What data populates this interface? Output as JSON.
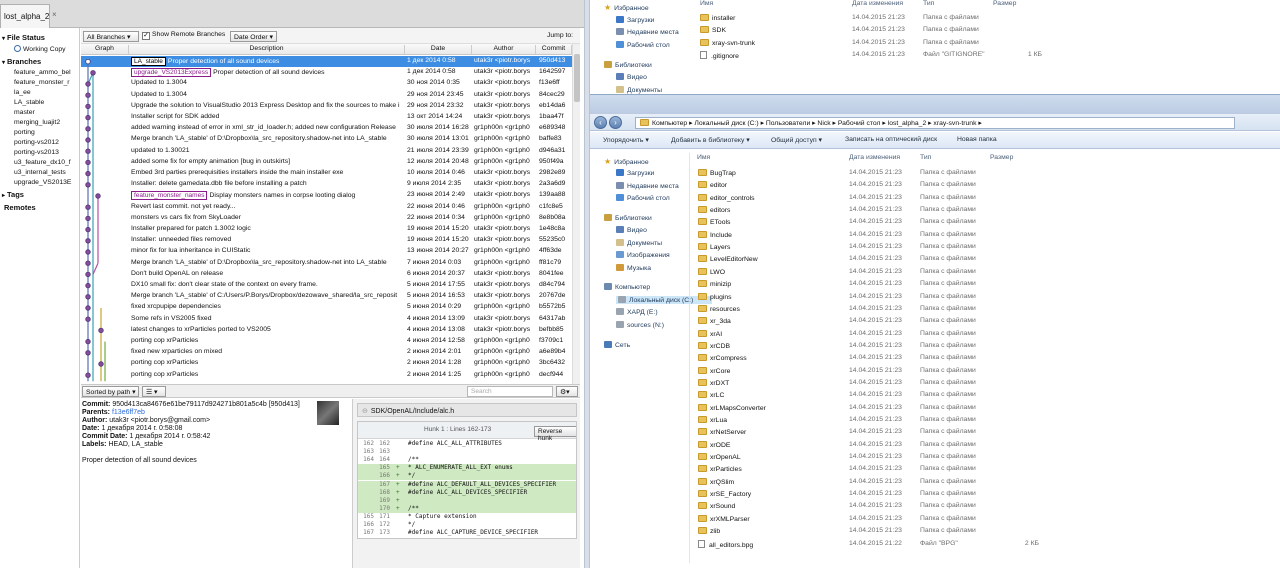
{
  "app": {
    "tab_label": "lost_alpha_2"
  },
  "sidebar": {
    "file_status": "File Status",
    "working_copy": "Working Copy",
    "branches_head": "Branches",
    "branches": [
      "feature_ammo_bel",
      "feature_monster_r",
      "la_ee",
      "LA_stable",
      "master",
      "merging_luajit2",
      "porting",
      "porting-vs2012",
      "porting-vs2013",
      "u3_feature_dx10_f",
      "u3_internal_tests",
      "upgrade_VS2013E"
    ],
    "tags_head": "Tags",
    "remotes_head": "Remotes"
  },
  "toolbar": {
    "branches_select": "All Branches",
    "show_remote": "Show Remote Branches",
    "order_select": "Date Order",
    "jump_to": "Jump to:"
  },
  "columns": {
    "graph": "Graph",
    "description": "Description",
    "date": "Date",
    "author": "Author",
    "commit": "Commit"
  },
  "commits": [
    {
      "tags": [
        {
          "label": "LA_stable",
          "kind": "tag"
        }
      ],
      "desc": "Proper detection of all sound devices",
      "date": "1 дек 2014 0:58",
      "author": "utak3r <piotr.borys",
      "hash": "950d413",
      "selected": true
    },
    {
      "tags": [
        {
          "label": "upgrade_VS2013Express",
          "kind": "branch"
        }
      ],
      "desc": "Proper detection of all sound devices",
      "date": "1 дек 2014 0:58",
      "author": "utak3r <piotr.borys",
      "hash": "1642597"
    },
    {
      "desc": "Updated to 1.3004",
      "date": "30 ноя 2014 0:35",
      "author": "utak3r <piotr.borys",
      "hash": "f13e6ff"
    },
    {
      "desc": "Updated to 1.3004",
      "date": "29 ноя 2014 23:45",
      "author": "utak3r <piotr.borys",
      "hash": "84cec29"
    },
    {
      "desc": "Upgrade the solution to VisualStudio 2013 Express Desktop and fix the sources to make i",
      "date": "29 ноя 2014 23:32",
      "author": "utak3r <piotr.borys",
      "hash": "eb14da6"
    },
    {
      "desc": "Installer script for SDK added",
      "date": "13 окт 2014 14:24",
      "author": "utak3r <piotr.borys",
      "hash": "1baa47f"
    },
    {
      "desc": "added warning instead of error in xml_str_id_loader.h; added new configuration Release",
      "date": "30 июля 2014 16:28",
      "author": "gr1ph00n <gr1ph0",
      "hash": "e689348"
    },
    {
      "desc": "Merge branch 'LA_stable' of D:\\Dropbox\\la_src_repository.shadow-net into LA_stable",
      "date": "30 июля 2014 13:01",
      "author": "gr1ph00n <gr1ph0",
      "hash": "baffe83"
    },
    {
      "desc": "updated to 1.30021",
      "date": "21 июля 2014 23:39",
      "author": "gr1ph00n <gr1ph0",
      "hash": "d946a31"
    },
    {
      "desc": "added some fix for empty animation [bug in outskirts]",
      "date": "12 июля 2014 20:48",
      "author": "gr1ph00n <gr1ph0",
      "hash": "950f49a"
    },
    {
      "desc": "Embed 3rd parties prerequisities installers inside the main installer exe",
      "date": "10 июля 2014 0:46",
      "author": "utak3r <piotr.borys",
      "hash": "2982e89"
    },
    {
      "desc": "Installer: delete gamedata.dbb file before installing a patch",
      "date": "9 июля 2014 2:35",
      "author": "utak3r <piotr.borys",
      "hash": "2a3a6d9"
    },
    {
      "tags": [
        {
          "label": "feature_monster_names",
          "kind": "branch"
        }
      ],
      "desc": "Display monsters names in corpse looting  dialog",
      "date": "23 июня 2014 2:49",
      "author": "utak3r <piotr.borys",
      "hash": "139aa88"
    },
    {
      "desc": "Revert last commit. not yet ready...",
      "date": "22 июня 2014 0:46",
      "author": "gr1ph00n <gr1ph0",
      "hash": "c1fc8e5"
    },
    {
      "desc": "monsters vs cars fix from SkyLoader",
      "date": "22 июня 2014 0:34",
      "author": "gr1ph00n <gr1ph0",
      "hash": "8e8b08a"
    },
    {
      "desc": "Installer prepared for patch 1.3002 logic",
      "date": "19 июня 2014 15:20",
      "author": "utak3r <piotr.borys",
      "hash": "1e48c8a"
    },
    {
      "desc": "Installer: unneeded files removed",
      "date": "19 июня 2014 15:20",
      "author": "utak3r <piotr.borys",
      "hash": "55235c0"
    },
    {
      "desc": "minor fix for lua inheritance in CUIStatic",
      "date": "13 июня 2014 20:27",
      "author": "gr1ph00n <gr1ph0",
      "hash": "4ff63de"
    },
    {
      "desc": "Merge branch 'LA_stable' of D:\\Dropbox\\la_src_repository.shadow-net into LA_stable",
      "date": "7 июня 2014 0:03",
      "author": "gr1ph00n <gr1ph0",
      "hash": "ff81c79"
    },
    {
      "desc": "Don't build OpenAL on release",
      "date": "6 июня 2014 20:37",
      "author": "utak3r <piotr.borys",
      "hash": "8041fee"
    },
    {
      "desc": "DX10 small fix: don't clear state of the context on every frame.",
      "date": "5 июня 2014 17:55",
      "author": "utak3r <piotr.borys",
      "hash": "d84c794"
    },
    {
      "desc": "Merge branch 'LA_stable' of C:/Users/P.Borys/Dropbox/dezowave_shared/la_src_reposit",
      "date": "5 июня 2014 16:53",
      "author": "utak3r <piotr.borys",
      "hash": "20767de"
    },
    {
      "desc": "fixed xrcpupipe dependencies",
      "date": "5 июня 2014 0:29",
      "author": "gr1ph00n <gr1ph0",
      "hash": "b5572b5"
    },
    {
      "desc": "Some refs in VS2005 fixed",
      "date": "4 июня 2014 13:09",
      "author": "utak3r <piotr.borys",
      "hash": "64317ab"
    },
    {
      "desc": "latest changes to xrParticles ported to VS2005",
      "date": "4 июня 2014 13:08",
      "author": "utak3r <piotr.borys",
      "hash": "befbb85"
    },
    {
      "desc": "porting cop xrParticles",
      "date": "4 июня 2014 12:58",
      "author": "gr1ph00n <gr1ph0",
      "hash": "f3709c1"
    },
    {
      "desc": "fixed new xrparticles on mixed",
      "date": "2 июня 2014 2:01",
      "author": "gr1ph00n <gr1ph0",
      "hash": "a6e89b4"
    },
    {
      "desc": "porting cop xrParticles",
      "date": "2 июня 2014 1:28",
      "author": "gr1ph00n <gr1ph0",
      "hash": "3bc6432"
    },
    {
      "desc": "porting cop xrParticles",
      "date": "2 июня 2014 1:25",
      "author": "gr1ph00n <gr1ph0",
      "hash": "decf944"
    }
  ],
  "bottom_toolbar": {
    "sort_label": "Sorted by path",
    "search_placeholder": "Search"
  },
  "commit_details": {
    "commit_label": "Commit:",
    "commit_value": "950d413ca84676e61be79117d924271b801a5c4b [950d413]",
    "parents_label": "Parents:",
    "parents_value": "f13e6ff7eb",
    "author_label": "Author:",
    "author_value": "utak3r <piotr.borys@gmail.com>",
    "date_label": "Date:",
    "date_value": "1 декабря 2014 г. 0:58:08",
    "commit_date_label": "Commit Date:",
    "commit_date_value": "1 декабря 2014 г. 0:58:42",
    "labels_label": "Labels:",
    "labels_value": "HEAD, LA_stable",
    "message": "Proper detection of all sound devices"
  },
  "diff": {
    "file_path": "SDK/OpenAL/Include/alc.h",
    "hunk_label": "Hunk 1 : Lines 162-173",
    "reverse_hunk": "Reverse hunk",
    "lines": [
      {
        "old": "162",
        "new": "162",
        "mark": "",
        "text": "#define ALC_ALL_ATTRIBUTES",
        "add": false
      },
      {
        "old": "163",
        "new": "163",
        "mark": "",
        "text": "",
        "add": false
      },
      {
        "old": "164",
        "new": "164",
        "mark": "",
        "text": "/**",
        "add": false
      },
      {
        "old": "",
        "new": "165",
        "mark": "+",
        "text": " * ALC_ENUMERATE_ALL_EXT enums",
        "add": true
      },
      {
        "old": "",
        "new": "166",
        "mark": "+",
        "text": " */",
        "add": true
      },
      {
        "old": "",
        "new": "167",
        "mark": "+",
        "text": "#define ALC_DEFAULT_ALL_DEVICES_SPECIFIER",
        "add": true
      },
      {
        "old": "",
        "new": "168",
        "mark": "+",
        "text": "#define ALC_ALL_DEVICES_SPECIFIER",
        "add": true
      },
      {
        "old": "",
        "new": "169",
        "mark": "+",
        "text": "",
        "add": true
      },
      {
        "old": "",
        "new": "170",
        "mark": "+",
        "text": "/**",
        "add": true
      },
      {
        "old": "165",
        "new": "171",
        "mark": "",
        "text": " * Capture extension",
        "add": false
      },
      {
        "old": "166",
        "new": "172",
        "mark": "",
        "text": " */",
        "add": false
      },
      {
        "old": "167",
        "new": "173",
        "mark": "",
        "text": "#define ALC_CAPTURE_DEVICE_SPECIFIER",
        "add": false
      }
    ]
  },
  "explorer_top": {
    "nav": [
      {
        "label": "Избранное",
        "icon": "star-icon",
        "head": true
      },
      {
        "label": "Загрузки",
        "icon": "downloads-icon"
      },
      {
        "label": "Недавние места",
        "icon": "recent-places-icon"
      },
      {
        "label": "Рабочий стол",
        "icon": "desktop-icon"
      },
      {
        "label": "Библиотеки",
        "icon": "libraries-icon",
        "head": true
      },
      {
        "label": "Видео",
        "icon": "video-icon"
      },
      {
        "label": "Документы",
        "icon": "documents-icon"
      }
    ],
    "columns": {
      "name": "Имя",
      "date": "Дата изменения",
      "type": "Тип",
      "size": "Размер"
    },
    "files": [
      {
        "name": "installer",
        "date": "14.04.2015 21:23",
        "type": "Папка с файлами",
        "size": "",
        "kind": "folder"
      },
      {
        "name": "SDK",
        "date": "14.04.2015 21:23",
        "type": "Папка с файлами",
        "size": "",
        "kind": "folder"
      },
      {
        "name": "xray-svn-trunk",
        "date": "14.04.2015 21:23",
        "type": "Папка с файлами",
        "size": "",
        "kind": "folder"
      },
      {
        "name": ".gitignore",
        "date": "14.04.2015 21:23",
        "type": "Файл \"GITIGNORE\"",
        "size": "1 КБ",
        "kind": "file"
      }
    ]
  },
  "explorer_main": {
    "breadcrumb": "Компьютер ▸ Локальный диск (C:) ▸ Пользователи ▸ Nick ▸ Рабочий стол ▸ lost_alpha_2 ▸ xray-svn-trunk ▸",
    "commands": [
      "Упорядочить ▾",
      "Добавить в библиотеку ▾",
      "Общий доступ ▾",
      "Записать на оптический диск",
      "Новая папка"
    ],
    "nav": [
      {
        "label": "Избранное",
        "icon": "star-icon",
        "head": true
      },
      {
        "label": "Загрузки",
        "icon": "downloads-icon"
      },
      {
        "label": "Недавние места",
        "icon": "recent-places-icon"
      },
      {
        "label": "Рабочий стол",
        "icon": "desktop-icon"
      },
      {
        "label": "Библиотеки",
        "icon": "libraries-icon",
        "head": true
      },
      {
        "label": "Видео",
        "icon": "video-icon"
      },
      {
        "label": "Документы",
        "icon": "documents-icon"
      },
      {
        "label": "Изображения",
        "icon": "images-icon"
      },
      {
        "label": "Музыка",
        "icon": "music-icon"
      },
      {
        "label": "Компьютер",
        "icon": "computer-icon",
        "head": true
      },
      {
        "label": "Локальный диск (C:)",
        "icon": "drive-icon",
        "selected": true
      },
      {
        "label": "ХАРД (E:)",
        "icon": "drive-icon"
      },
      {
        "label": "sources (N:)",
        "icon": "drive-icon"
      },
      {
        "label": "Сеть",
        "icon": "network-icon",
        "head": true
      }
    ],
    "columns": {
      "name": "Имя",
      "date": "Дата изменения",
      "type": "Тип",
      "size": "Размер"
    },
    "files": [
      {
        "name": "BugTrap",
        "date": "14.04.2015 21:23",
        "type": "Папка с файлами",
        "size": "",
        "kind": "folder"
      },
      {
        "name": "editor",
        "date": "14.04.2015 21:23",
        "type": "Папка с файлами",
        "size": "",
        "kind": "folder"
      },
      {
        "name": "editor_controls",
        "date": "14.04.2015 21:23",
        "type": "Папка с файлами",
        "size": "",
        "kind": "folder"
      },
      {
        "name": "editors",
        "date": "14.04.2015 21:23",
        "type": "Папка с файлами",
        "size": "",
        "kind": "folder"
      },
      {
        "name": "ETools",
        "date": "14.04.2015 21:23",
        "type": "Папка с файлами",
        "size": "",
        "kind": "folder"
      },
      {
        "name": "Include",
        "date": "14.04.2015 21:23",
        "type": "Папка с файлами",
        "size": "",
        "kind": "folder"
      },
      {
        "name": "Layers",
        "date": "14.04.2015 21:23",
        "type": "Папка с файлами",
        "size": "",
        "kind": "folder"
      },
      {
        "name": "LevelEditorNew",
        "date": "14.04.2015 21:23",
        "type": "Папка с файлами",
        "size": "",
        "kind": "folder"
      },
      {
        "name": "LWO",
        "date": "14.04.2015 21:23",
        "type": "Папка с файлами",
        "size": "",
        "kind": "folder"
      },
      {
        "name": "minizip",
        "date": "14.04.2015 21:23",
        "type": "Папка с файлами",
        "size": "",
        "kind": "folder"
      },
      {
        "name": "plugins",
        "date": "14.04.2015 21:23",
        "type": "Папка с файлами",
        "size": "",
        "kind": "folder"
      },
      {
        "name": "resources",
        "date": "14.04.2015 21:23",
        "type": "Папка с файлами",
        "size": "",
        "kind": "folder"
      },
      {
        "name": "xr_3da",
        "date": "14.04.2015 21:23",
        "type": "Папка с файлами",
        "size": "",
        "kind": "folder"
      },
      {
        "name": "xrAI",
        "date": "14.04.2015 21:23",
        "type": "Папка с файлами",
        "size": "",
        "kind": "folder"
      },
      {
        "name": "xrCDB",
        "date": "14.04.2015 21:23",
        "type": "Папка с файлами",
        "size": "",
        "kind": "folder"
      },
      {
        "name": "xrCompress",
        "date": "14.04.2015 21:23",
        "type": "Папка с файлами",
        "size": "",
        "kind": "folder"
      },
      {
        "name": "xrCore",
        "date": "14.04.2015 21:23",
        "type": "Папка с файлами",
        "size": "",
        "kind": "folder"
      },
      {
        "name": "xrDXT",
        "date": "14.04.2015 21:23",
        "type": "Папка с файлами",
        "size": "",
        "kind": "folder"
      },
      {
        "name": "xrLC",
        "date": "14.04.2015 21:23",
        "type": "Папка с файлами",
        "size": "",
        "kind": "folder"
      },
      {
        "name": "xrLMapsConverter",
        "date": "14.04.2015 21:23",
        "type": "Папка с файлами",
        "size": "",
        "kind": "folder"
      },
      {
        "name": "xrLua",
        "date": "14.04.2015 21:23",
        "type": "Папка с файлами",
        "size": "",
        "kind": "folder"
      },
      {
        "name": "xrNetServer",
        "date": "14.04.2015 21:23",
        "type": "Папка с файлами",
        "size": "",
        "kind": "folder"
      },
      {
        "name": "xrODE",
        "date": "14.04.2015 21:23",
        "type": "Папка с файлами",
        "size": "",
        "kind": "folder"
      },
      {
        "name": "xrOpenAL",
        "date": "14.04.2015 21:23",
        "type": "Папка с файлами",
        "size": "",
        "kind": "folder"
      },
      {
        "name": "xrParticles",
        "date": "14.04.2015 21:23",
        "type": "Папка с файлами",
        "size": "",
        "kind": "folder"
      },
      {
        "name": "xrQSlim",
        "date": "14.04.2015 21:23",
        "type": "Папка с файлами",
        "size": "",
        "kind": "folder"
      },
      {
        "name": "xrSE_Factory",
        "date": "14.04.2015 21:23",
        "type": "Папка с файлами",
        "size": "",
        "kind": "folder"
      },
      {
        "name": "xrSound",
        "date": "14.04.2015 21:23",
        "type": "Папка с файлами",
        "size": "",
        "kind": "folder"
      },
      {
        "name": "xrXMLParser",
        "date": "14.04.2015 21:23",
        "type": "Папка с файлами",
        "size": "",
        "kind": "folder"
      },
      {
        "name": "zlib",
        "date": "14.04.2015 21:23",
        "type": "Папка с файлами",
        "size": "",
        "kind": "folder"
      },
      {
        "name": "all_editors.bpg",
        "date": "14.04.2015 21:22",
        "type": "Файл \"BPG\"",
        "size": "2 КБ",
        "kind": "file"
      }
    ]
  }
}
